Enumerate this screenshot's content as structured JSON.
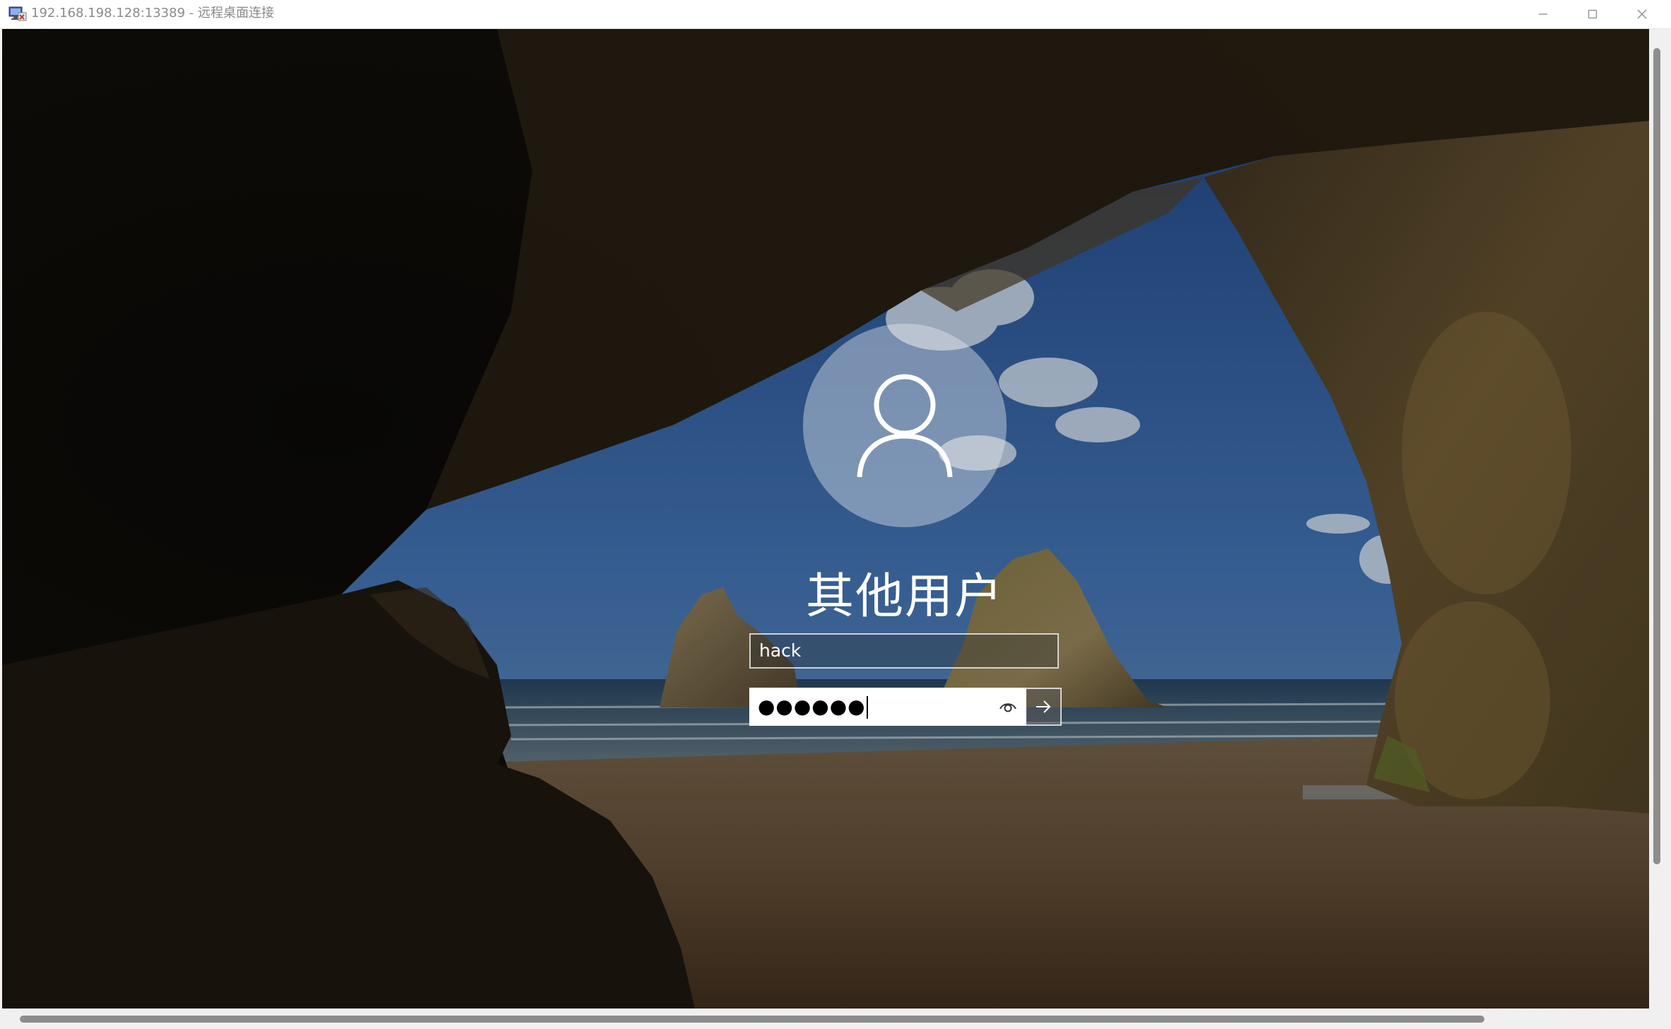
{
  "window": {
    "title": "192.168.198.128:13389 - 远程桌面连接",
    "app_icon": "remote-desktop-icon",
    "controls": [
      "minimize-icon",
      "maximize-icon",
      "close-icon"
    ]
  },
  "login": {
    "avatar_icon": "user-icon",
    "user_label": "其他用户",
    "username_value": "hack",
    "password_masked": "●●●●●●",
    "reveal_icon": "eye-icon",
    "submit_icon": "arrow-right-icon"
  },
  "colors": {
    "titlebar": "#ffffff",
    "title_text": "#8a8a8a",
    "field_white": "#ffffff",
    "scrollbar_thumb": "#8d8d8d"
  }
}
